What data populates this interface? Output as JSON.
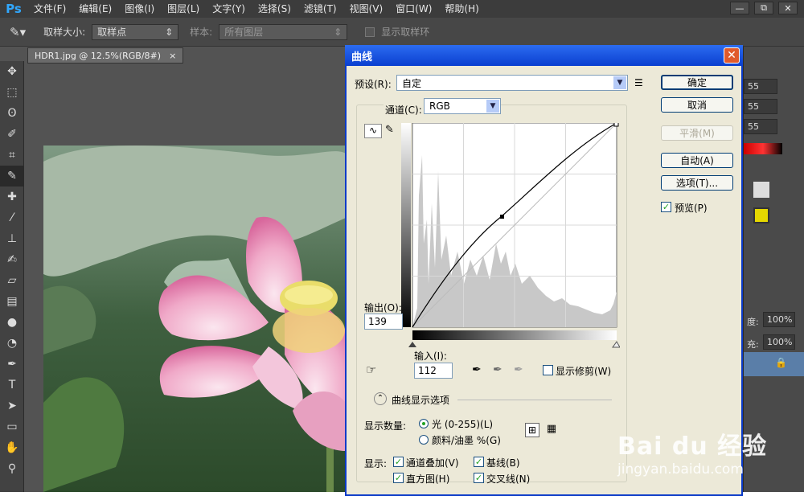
{
  "app": {
    "logo": "Ps"
  },
  "menubar": {
    "items": [
      "文件(F)",
      "编辑(E)",
      "图像(I)",
      "图层(L)",
      "文字(Y)",
      "选择(S)",
      "滤镜(T)",
      "视图(V)",
      "窗口(W)",
      "帮助(H)"
    ]
  },
  "window_buttons": {
    "minimize": "—",
    "restore": "⧉",
    "close": "✕"
  },
  "options_bar": {
    "sample_size_label": "取样大小:",
    "sample_size_value": "取样点",
    "sample_label": "样本:",
    "sample_value": "所有图层",
    "show_ring_label": "显示取样环"
  },
  "document_tab": {
    "title": "HDR1.jpg @ 12.5%(RGB/8#)",
    "close": "×"
  },
  "right_panel": {
    "values": [
      "55",
      "55",
      "55"
    ],
    "opacity_label": "度:",
    "opacity_value": "100%",
    "fill_label": "充:",
    "fill_value": "100%"
  },
  "dialog": {
    "title": "曲线",
    "close": "✕",
    "preset_label": "预设(R):",
    "preset_value": "自定",
    "channel_label": "通道(C):",
    "channel_value": "RGB",
    "output_label": "输出(O):",
    "output_value": "139",
    "input_label": "输入(I):",
    "input_value": "112",
    "show_clipping_label": "显示修剪(W)",
    "curve_options_label": "曲线显示选项",
    "show_amount_label": "显示数量:",
    "light_label": "光 (0-255)(L)",
    "pigment_label": "颜料/油墨 %(G)",
    "show_label": "显示:",
    "channel_overlay_label": "通道叠加(V)",
    "baseline_label": "基线(B)",
    "histogram_label": "直方图(H)",
    "intersection_label": "交叉线(N)",
    "buttons": {
      "ok": "确定",
      "cancel": "取消",
      "smooth": "平滑(M)",
      "auto": "自动(A)",
      "options": "选项(T)..."
    },
    "preview_label": "预览(P)"
  },
  "watermark": {
    "brand": "Bai du 经验",
    "url": "jingyan.baidu.com"
  }
}
